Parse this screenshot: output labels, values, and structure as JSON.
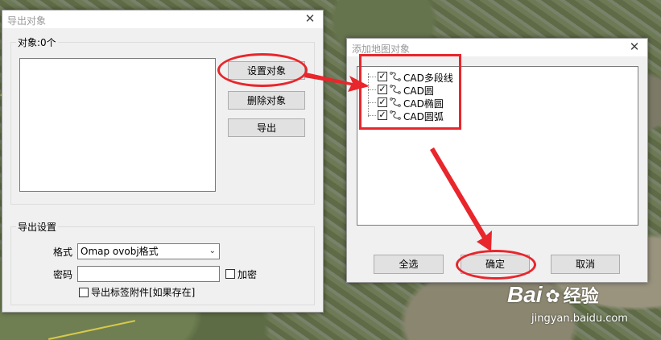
{
  "left_dialog": {
    "title": "导出对象",
    "objects_group_label": "对象:0个",
    "buttons": {
      "set": "设置对象",
      "delete": "删除对象",
      "export": "导出"
    },
    "export_settings": {
      "group_label": "导出设置",
      "format_label": "格式",
      "format_value": "Omap ovobj格式",
      "password_label": "密码",
      "password_value": "",
      "encrypt_label": "加密",
      "export_tags_label": "导出标签附件[如果存在]"
    }
  },
  "right_dialog": {
    "title": "添加地图对象",
    "tree": [
      {
        "label": "CAD多段线",
        "checked": true
      },
      {
        "label": "CAD圆",
        "checked": true
      },
      {
        "label": "CAD椭圆",
        "checked": true
      },
      {
        "label": "CAD圆弧",
        "checked": true
      }
    ],
    "buttons": {
      "select_all": "全选",
      "ok": "确定",
      "cancel": "取消"
    }
  },
  "watermark": {
    "brand": "Bai",
    "brand2": "经验",
    "url": "jingyan.baidu.com"
  },
  "colors": {
    "annotation": "#e8262c",
    "window_bg": "#f0f0f0",
    "button_bg": "#e1e1e1"
  }
}
